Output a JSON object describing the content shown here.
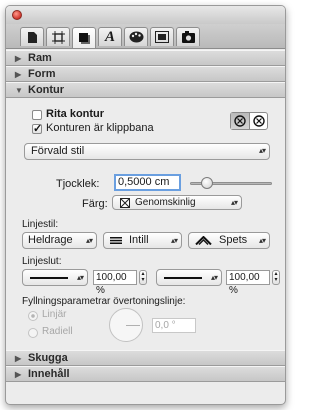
{
  "tabs": [
    {
      "icon": "document-icon",
      "active": false
    },
    {
      "icon": "frame-icon",
      "active": false
    },
    {
      "icon": "shape-icon",
      "active": true
    },
    {
      "icon": "text-icon",
      "glyph": "A",
      "active": false
    },
    {
      "icon": "color-palette-icon",
      "active": false
    },
    {
      "icon": "image-icon",
      "active": false
    },
    {
      "icon": "camera-icon",
      "active": false
    }
  ],
  "sections": {
    "ram": "Ram",
    "form": "Form",
    "kontur": "Kontur",
    "skugga": "Skugga",
    "innehall": "Innehåll"
  },
  "kontur": {
    "rita_kontur": "Rita kontur",
    "rita_kontur_checked": false,
    "klippbana": "Konturen är klippbana",
    "klippbana_checked": true,
    "stil_value": "Förvald stil",
    "tjocklek_label": "Tjocklek:",
    "tjocklek_value": "0,5000 cm",
    "farg_label": "Färg:",
    "farg_value": "Genomskinlig",
    "linjestil_label": "Linjestil:",
    "linjestil_values": [
      "Heldrage",
      "Intill",
      "Spets"
    ],
    "linjeslut_label": "Linjeslut:",
    "linjeslut_pct_left": "100,00 %",
    "linjeslut_pct_right": "100,00 %",
    "gradient_label": "Fyllningsparametrar övertoningslinje:",
    "linjar": "Linjär",
    "radiell": "Radiell",
    "angle_value": "0,0 °"
  },
  "colors": {
    "accent": "#3b7fd6",
    "window_bg": "#ececec"
  }
}
